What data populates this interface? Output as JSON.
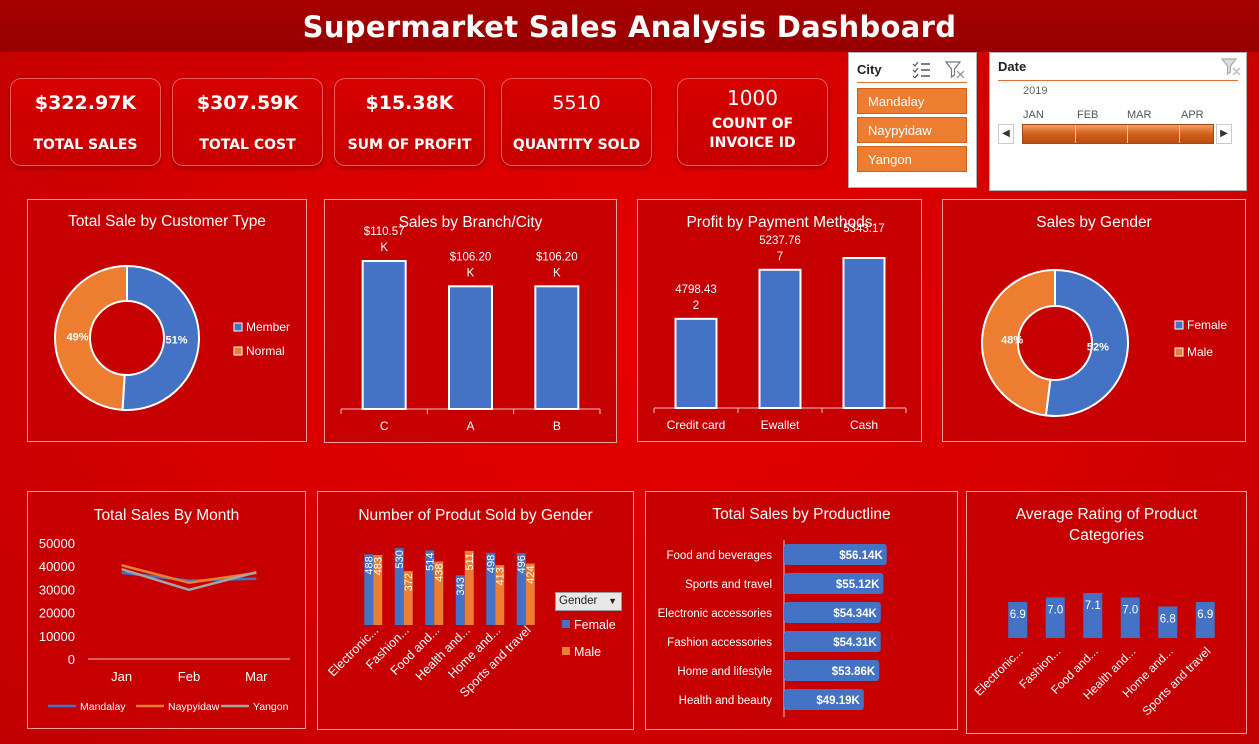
{
  "title": "Supermarket Sales Analysis Dashboard",
  "kpis": [
    {
      "value": "$322.97K",
      "label": "TOTAL SALES"
    },
    {
      "value": "$307.59K",
      "label": "TOTAL COST"
    },
    {
      "value": "$15.38K",
      "label": "SUM OF PROFIT"
    },
    {
      "value": "5510",
      "label": "QUANTITY SOLD"
    },
    {
      "value": "1000",
      "label_line1": "COUNT OF",
      "label_line2": "INVOICE ID"
    }
  ],
  "city_slicer": {
    "header": "City",
    "options": [
      "Mandalay",
      "Naypyidaw",
      "Yangon"
    ],
    "icons": [
      "multi-select-icon",
      "clear-filter-icon"
    ]
  },
  "date_slicer": {
    "header": "Date",
    "year": "2019",
    "months": [
      "JAN",
      "FEB",
      "MAR",
      "APR"
    ],
    "icons": [
      "clear-filter-icon",
      "scroll-left-icon",
      "scroll-right-icon"
    ]
  },
  "colors": {
    "blue": "#4472c4",
    "orange": "#ed7d31",
    "gray": "#a5a5a5",
    "title_bar": "#a00000",
    "background": "#d40000"
  },
  "chart_data": [
    {
      "id": "customer_type",
      "type": "pie",
      "title": "Total Sale by Customer Type",
      "categories": [
        "Member",
        "Normal"
      ],
      "values": [
        51,
        49
      ],
      "labels": [
        "51%",
        "49%"
      ],
      "legend": "right"
    },
    {
      "id": "branch",
      "type": "bar",
      "title": "Sales by Branch/City",
      "categories": [
        "C",
        "A",
        "B"
      ],
      "values": [
        110.57,
        106.2,
        106.2
      ],
      "labels": [
        [
          "$110.57",
          "K"
        ],
        [
          "$106.20",
          "K"
        ],
        [
          "$106.20",
          "K"
        ]
      ],
      "unit": "K"
    },
    {
      "id": "payment",
      "type": "bar",
      "title": "Profit by Payment Methods",
      "categories": [
        "Credit card",
        "Ewallet",
        "Cash"
      ],
      "values": [
        4798.432,
        5237.767,
        5343.17
      ],
      "labels": [
        [
          "4798.43",
          "2"
        ],
        [
          "5237.76",
          "7"
        ],
        [
          "5343.17",
          ""
        ]
      ]
    },
    {
      "id": "gender",
      "type": "pie",
      "title": "Sales by Gender",
      "categories": [
        "Female",
        "Male"
      ],
      "values": [
        52,
        48
      ],
      "labels": [
        "52%",
        "48%"
      ],
      "legend": "right"
    },
    {
      "id": "month",
      "type": "line",
      "title": "Total Sales By Month",
      "categories": [
        "Jan",
        "Feb",
        "Mar"
      ],
      "series": [
        {
          "name": "Mandalay",
          "values": [
            37200,
            33800,
            34600
          ]
        },
        {
          "name": "Naypyidaw",
          "values": [
            40400,
            32900,
            37100
          ]
        },
        {
          "name": "Yangon",
          "values": [
            38700,
            29800,
            37400
          ]
        }
      ],
      "ylim": [
        0,
        50000
      ],
      "yticks": [
        "50000",
        "40000",
        "30000",
        "20000",
        "10000",
        "0"
      ],
      "legend": "bottom"
    },
    {
      "id": "product_gender",
      "type": "bar",
      "title": "Number of Produt Sold by Gender",
      "categories": [
        "Electronic...",
        "Fashion...",
        "Food and...",
        "Health and...",
        "Home and...",
        "Sports and travel"
      ],
      "series": [
        {
          "name": "Female",
          "values": [
            488,
            530,
            514,
            343,
            498,
            496
          ]
        },
        {
          "name": "Male",
          "values": [
            483,
            372,
            438,
            511,
            413,
            424
          ]
        }
      ],
      "filter_button": "Gender",
      "legend": "right"
    },
    {
      "id": "productline",
      "type": "bar",
      "title": "Total Sales by Productline",
      "categories": [
        "Food and beverages",
        "Sports and travel",
        "Electronic accessories",
        "Fashion accessories",
        "Home and lifestyle",
        "Health and beauty"
      ],
      "values": [
        56.14,
        55.12,
        54.34,
        54.31,
        53.86,
        49.19
      ],
      "labels": [
        "$56.14K",
        "$55.12K",
        "$54.34K",
        "$54.31K",
        "$53.86K",
        "$49.19K"
      ],
      "orientation": "horizontal",
      "unit": "K"
    },
    {
      "id": "rating",
      "type": "bar",
      "title": "Average Rating of Product Categories",
      "categories": [
        "Electronic...",
        "Fashion...",
        "Food and...",
        "Health and...",
        "Home and...",
        "Sports and travel"
      ],
      "values": [
        6.9,
        7.0,
        7.1,
        7.0,
        6.8,
        6.9
      ],
      "labels": [
        "6.9",
        "7.0",
        "7.1",
        "7.0",
        "6.8",
        "6.9"
      ]
    }
  ]
}
